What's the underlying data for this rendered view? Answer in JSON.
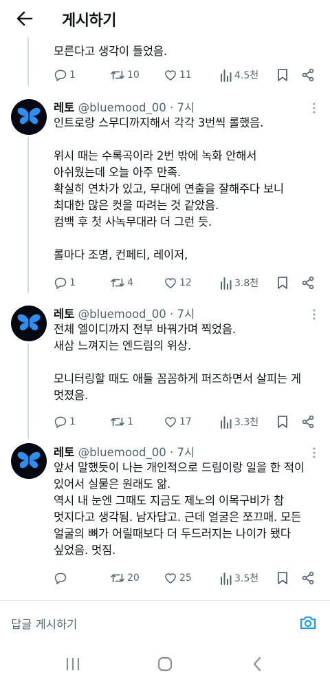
{
  "header": {
    "title": "게시하기"
  },
  "previous_post": {
    "text_tail": "모른다고 생각이 들었음.",
    "reply_count": "1",
    "retweet_count": "10",
    "like_count": "11",
    "view_count": "4.5천"
  },
  "posts": [
    {
      "name": "레토",
      "handle": "@bluemood_00",
      "time": "· 7시",
      "text": "인트로랑 스무디까지해서 각각 3번씩 롤했음.\n\n위시 때는 수록곡이라 2번 밖에 녹화 안해서\n아쉬웠는데 오늘 아주 만족.\n확실히 연차가 있고, 무대에 연출을 잘해주다 보니\n최대한 많은 컷을 따려는 것 같았음.\n컴백 후 첫 사녹무대라 더 그런 듯.\n\n롤마다 조명, 컨페티, 레이저,",
      "reply_count": "1",
      "retweet_count": "4",
      "like_count": "12",
      "view_count": "3.8천"
    },
    {
      "name": "레토",
      "handle": "@bluemood_00",
      "time": "· 7시",
      "text": "전체 엘이디까지 전부 바꿔가며 찍었음.\n새삼 느껴지는 엔드림의 위상.\n\n모니터링할 때도 애들 꼼꼼하게 퍼즈하면서 살피는 게\n멋졌음.",
      "reply_count": "1",
      "retweet_count": "1",
      "like_count": "17",
      "view_count": "3.3천"
    },
    {
      "name": "레토",
      "handle": "@bluemood_00",
      "time": "· 7시",
      "text": "앞서 말했듯이 나는 개인적으로 드림이랑 일을 한 적이\n있어서 실물은 원래도 앎.\n역시 내 눈엔 그때도 지금도 제노의 이목구비가 참\n멋지다고 생각됨. 남자답고. 근데 얼굴은 쪼끄매. 모든\n얼굴의 뼈가 어릴때보다 더 두드러지는 나이가 됐다\n싶었음. 멋짐.",
      "reply_count": "",
      "retweet_count": "20",
      "like_count": "25",
      "view_count": "3.5천"
    }
  ],
  "reply_bar": {
    "placeholder": "답글 게시하기"
  },
  "colors": {
    "accent": "#1d9bf0",
    "text": "#0f1419",
    "muted": "#536471",
    "thread_line": "#cfd9de"
  },
  "icons": [
    "back-arrow-icon",
    "reply-icon",
    "retweet-icon",
    "like-icon",
    "views-icon",
    "bookmark-icon",
    "share-icon",
    "more-icon",
    "camera-icon",
    "recent-apps-icon",
    "home-icon",
    "back-nav-icon"
  ]
}
